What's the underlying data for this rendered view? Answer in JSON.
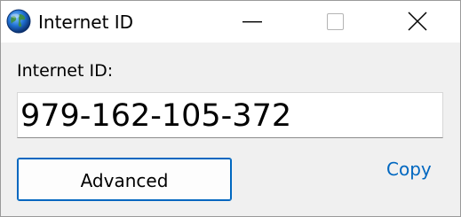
{
  "window": {
    "title": "Internet ID",
    "icon": "globe-icon",
    "controls": {
      "minimize": "minimize-icon",
      "maximize": "maximize-icon",
      "close": "close-icon"
    }
  },
  "main": {
    "label": "Internet ID:",
    "id_value": "979-162-105-372",
    "advanced_label": "Advanced",
    "copy_label": "Copy"
  },
  "colors": {
    "accent": "#0067c0",
    "window_bg": "#f0f0f0",
    "titlebar_bg": "#ffffff"
  }
}
